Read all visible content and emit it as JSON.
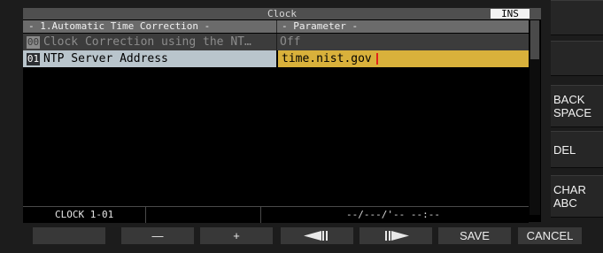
{
  "window": {
    "title": "Clock",
    "mode_badge": "INS"
  },
  "table": {
    "header_left": "- 1.Automatic Time Correction -",
    "header_right": "- Parameter -",
    "rows": [
      {
        "no": "00",
        "name": "Clock Correction using the NT…",
        "value": "Off"
      },
      {
        "no": "01",
        "name": "NTP Server Address",
        "value": "time.nist.gov"
      }
    ]
  },
  "status": {
    "label": "CLOCK 1-01",
    "time": "--/---/'--  --:--"
  },
  "soft_keys": {
    "k1": "",
    "k2": "",
    "k3": "BACK\nSPACE",
    "k4": "DEL",
    "k5": "CHAR\nABC"
  },
  "function_keys": {
    "f1": "",
    "f2": "—",
    "f3": "+",
    "f4": "left-arrow-icon",
    "f5": "right-arrow-icon",
    "f6": "SAVE",
    "f7": "CANCEL"
  },
  "colors": {
    "selected_row": "#b9c5cc",
    "edit_field": "#d9b13b",
    "cursor": "#e0221a"
  }
}
